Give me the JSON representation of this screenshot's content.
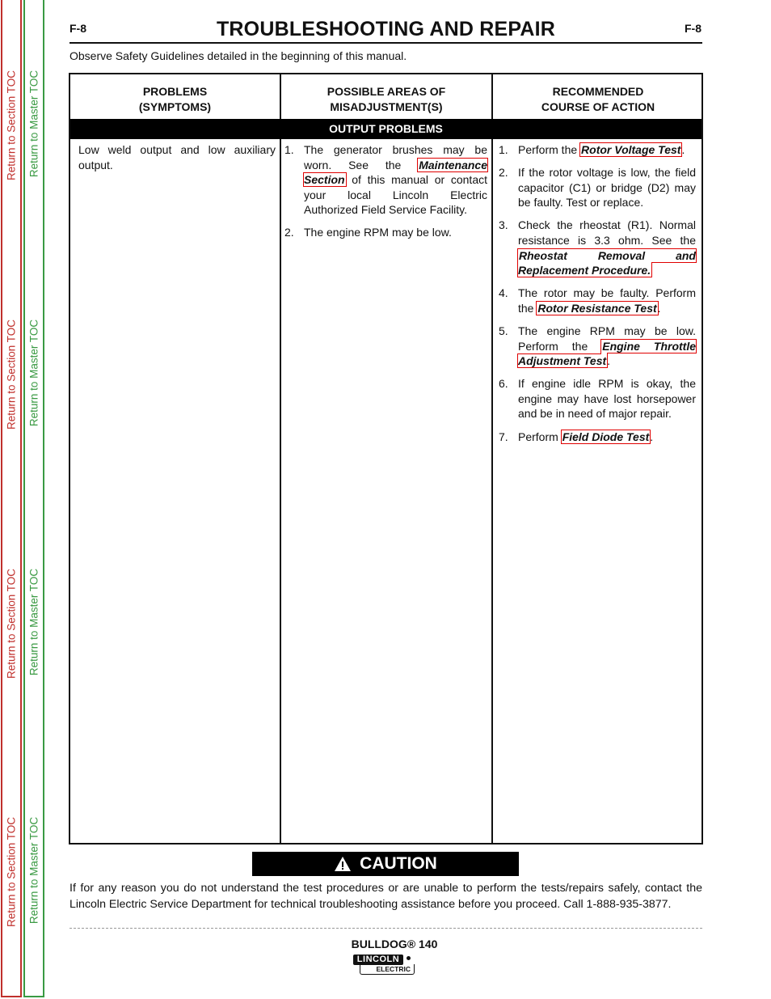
{
  "toc": {
    "section_label": "Return to Section TOC",
    "master_label": "Return to Master TOC",
    "section_color": "#c0302c",
    "master_color": "#3a9a43"
  },
  "header": {
    "page_code_left": "F-8",
    "page_code_right": "F-8",
    "title": "TROUBLESHOOTING AND REPAIR",
    "safety_note": "Observe Safety Guidelines detailed in the beginning of this manual."
  },
  "table": {
    "columns": [
      {
        "line1": "PROBLEMS",
        "line2": "(SYMPTOMS)"
      },
      {
        "line1": "POSSIBLE AREAS OF",
        "line2": "MISADJUSTMENT(S)"
      },
      {
        "line1": "RECOMMENDED",
        "line2": "COURSE OF ACTION"
      }
    ],
    "section": "OUTPUT PROBLEMS",
    "problem": "Low weld output and low auxiliary output.",
    "misadjustments": [
      {
        "num": "1.",
        "pre": "The generator brushes may be worn.  See the ",
        "link": "Maintenance Section",
        "post": " of this manual or contact your local Lincoln Electric Authorized Field Service Facility."
      },
      {
        "num": "2.",
        "pre": "The engine RPM may be low.",
        "link": null,
        "post": ""
      }
    ],
    "actions": [
      {
        "num": "1.",
        "pre": "Perform the ",
        "link": "Rotor Voltage Test",
        "post": "."
      },
      {
        "num": "2.",
        "pre": "If the rotor voltage is low, the field capacitor (C1) or bridge (D2) may be faulty.  Test or replace.",
        "link": null,
        "post": ""
      },
      {
        "num": "3.",
        "pre": "Check the rheostat (R1). Normal resistance is 3.3 ohm. See the ",
        "link": "Rheostat Removal and Replacement Procedure.",
        "post": ""
      },
      {
        "num": "4.",
        "pre": "The rotor may be faulty.  Perform the ",
        "link": "Rotor Resistance Test",
        "post": "."
      },
      {
        "num": "5.",
        "pre": "The engine RPM may be low. Perform the ",
        "link": "Engine Throttle Adjustment Test",
        "post": "."
      },
      {
        "num": "6.",
        "pre": "If engine idle RPM is okay, the engine may have lost horsepower and be in need of major repair.",
        "link": null,
        "post": ""
      },
      {
        "num": "7.",
        "pre": "Perform ",
        "link": "Field Diode Test",
        "post": "."
      }
    ]
  },
  "caution": {
    "label": "CAUTION",
    "icon": "warning-triangle-icon",
    "text": "If for any reason you do not understand the test procedures or are unable to perform the tests/repairs safely, contact the Lincoln Electric Service Department for technical troubleshooting assistance before you proceed. Call 1-888-935-3877."
  },
  "footer": {
    "model": "BULLDOG® 140",
    "logo_top": "LINCOLN",
    "logo_bottom": "ELECTRIC"
  }
}
